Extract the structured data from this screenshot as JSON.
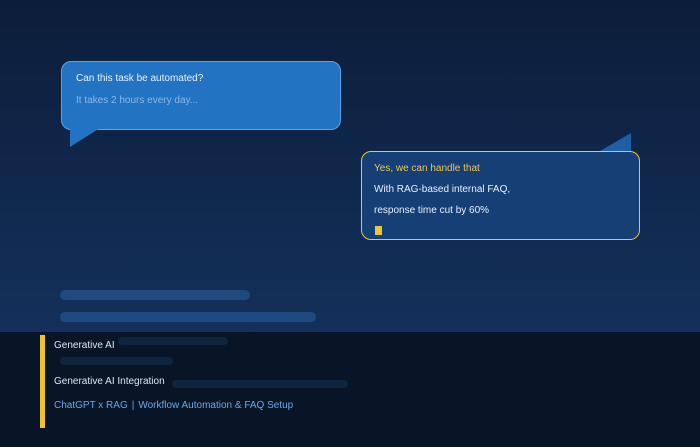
{
  "chat": {
    "question": {
      "title": "Can this task be automated?",
      "subtitle": "It takes 2 hours every day..."
    },
    "answer": {
      "title": "Yes, we can handle that",
      "line1": "With RAG-based internal FAQ,",
      "line2": "response time cut by 60%"
    }
  },
  "footer": {
    "category": "Generative AI",
    "title": "Generative AI Integration",
    "tag_1": "ChatGPT x RAG",
    "separator": "|",
    "tag_2": "Workflow Automation & FAQ Setup"
  },
  "colors": {
    "accent": "#efc22e",
    "question_bubble": "#2273c2",
    "answer_bubble": "#163f76",
    "link": "#6aa7e6"
  }
}
